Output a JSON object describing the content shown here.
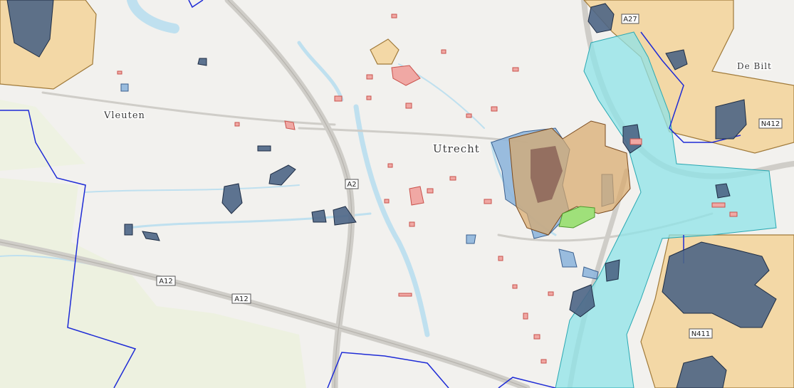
{
  "map": {
    "places": {
      "utrecht": "Utrecht",
      "vleuten": "Vleuten",
      "de_bilt": "De Bilt"
    },
    "roads": {
      "a2_north": "A2",
      "a12_west": "A12",
      "a12_mid": "A12",
      "a27": "A27",
      "n412": "N412",
      "n411": "N411"
    },
    "colors": {
      "background": "#f2f1ee",
      "green_land": "#edf1e0",
      "water": "#bfe0ef",
      "highway": "#cfcdc8",
      "boundary": "#1e2bd6",
      "cyan_zone": "#8ee3e8",
      "tan_zone": "#f3cf8e",
      "dark_blue_zone": "#4d6585",
      "light_blue_zone": "#8fb6dc",
      "red_monument": "#f0a8a4",
      "green_park": "#9fe07a",
      "label_text": "#3b3b3b"
    }
  }
}
